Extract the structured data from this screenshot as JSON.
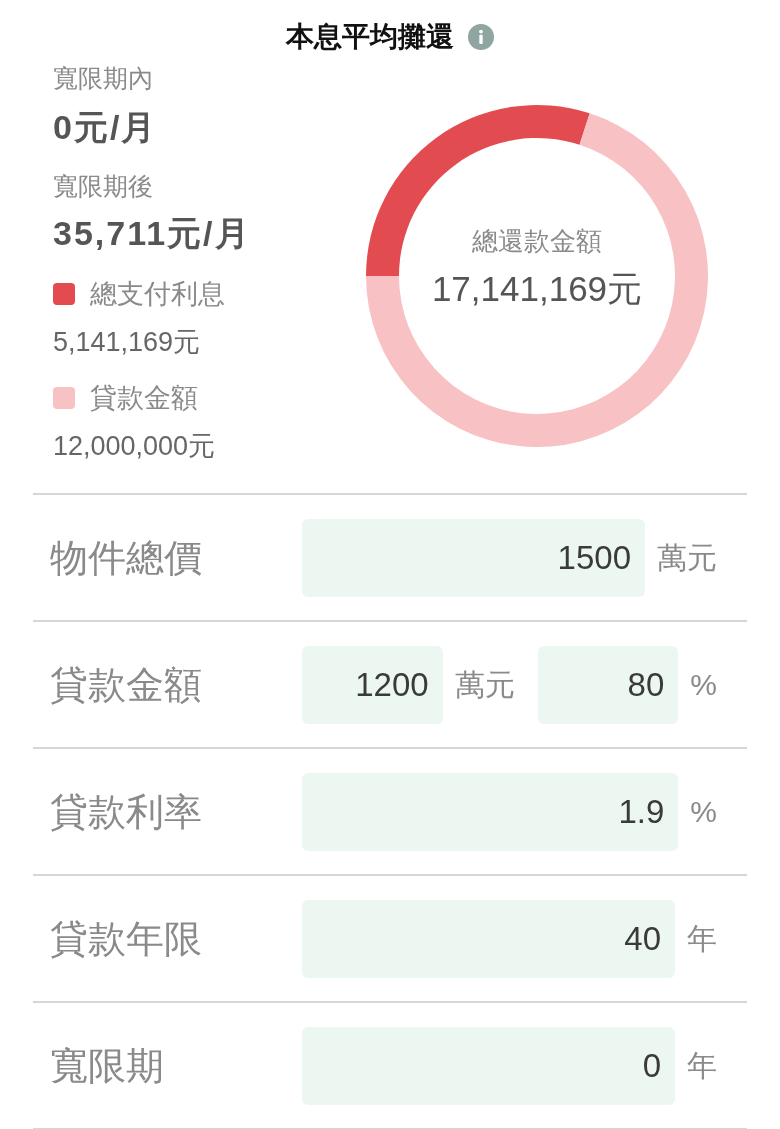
{
  "title": {
    "text": "本息平均攤還"
  },
  "summary": [
    {
      "label": "寬限期內",
      "value": "0元/月"
    },
    {
      "label": "寬限期後",
      "value": "35,711元/月"
    }
  ],
  "donut": {
    "chart_data": {
      "type": "donut",
      "categories": [
        "總支付利息",
        "貸款金額"
      ],
      "series": [
        {
          "name": "總還款金額",
          "values": [
            29.99,
            70.01
          ]
        }
      ]
    },
    "center_value": "17,141,169元",
    "legend": [
      {
        "value": "5,141,169元",
        "color": "#e24c50"
      },
      {
        "value": "12,000,000元",
        "color": "#f8c1c3"
      }
    ]
  },
  "form": [
    {
      "label": "物件總價",
      "fields": [
        {
          "value": "1500",
          "unit": "萬元"
        }
      ]
    },
    {
      "label": "貸款金額",
      "fields": [
        {
          "value": "1200",
          "unit": "萬元"
        },
        {
          "value": "80",
          "unit": "%"
        }
      ]
    },
    {
      "label": "貸款利率",
      "fields": [
        {
          "value": "1.9",
          "unit": "%"
        }
      ]
    },
    {
      "label": "貸款年限",
      "fields": [
        {
          "value": "40",
          "unit": "年"
        }
      ]
    },
    {
      "label": "寬限期",
      "fields": [
        {
          "value": "0",
          "unit": "年"
        }
      ]
    }
  ]
}
